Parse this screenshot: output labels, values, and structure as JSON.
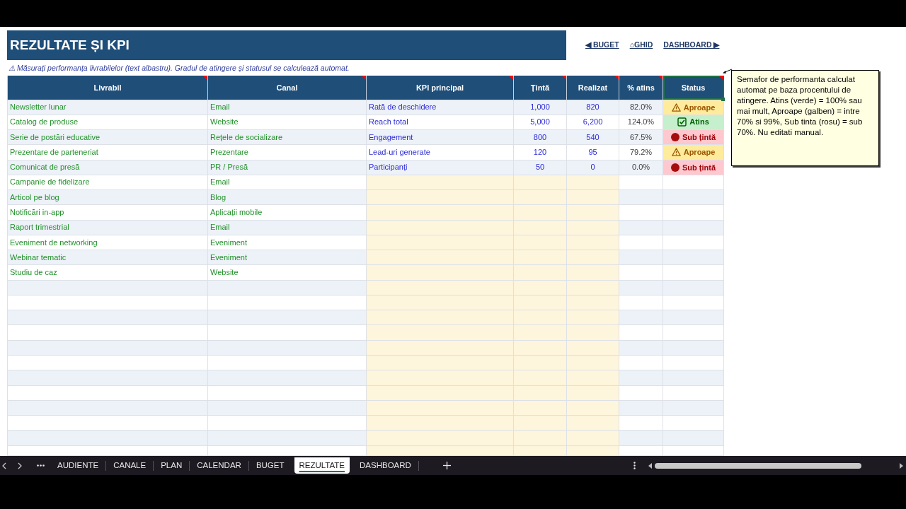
{
  "sheet": {
    "title": "REZULTATE ȘI KPI",
    "nav_links": [
      {
        "label": "◀ BUGET"
      },
      {
        "label": "⌂GHID"
      },
      {
        "label": "DASHBOARD ▶"
      }
    ],
    "note": "⚠ Măsurați performanța livrabilelor (text albastru). Gradul de atingere și statusul se calculează automat.",
    "table": {
      "columns": [
        {
          "label": "Livrabil",
          "comment": true,
          "selected": false
        },
        {
          "label": "Canal",
          "comment": true,
          "selected": false
        },
        {
          "label": "KPI principal",
          "comment": true,
          "selected": false
        },
        {
          "label": "Țintă",
          "comment": true,
          "selected": false
        },
        {
          "label": "Realizat",
          "comment": true,
          "selected": false
        },
        {
          "label": "% atins",
          "comment": true,
          "selected": false
        },
        {
          "label": "Status",
          "comment": true,
          "selected": true
        }
      ],
      "rows": [
        {
          "deliverable": "Newsletter lunar",
          "channel": "Email",
          "kpi": "Rată de deschidere",
          "target": "1,000",
          "actual": "820",
          "percent": "82.0%",
          "status": {
            "kind": "near",
            "label": "Aproape"
          }
        },
        {
          "deliverable": "Catalog de produse",
          "channel": "Website",
          "kpi": "Reach total",
          "target": "5,000",
          "actual": "6,200",
          "percent": "124.0%",
          "status": {
            "kind": "met",
            "label": "Atins"
          }
        },
        {
          "deliverable": "Serie de postări educative",
          "channel": "Rețele de socializare",
          "kpi": "Engagement",
          "target": "800",
          "actual": "540",
          "percent": "67.5%",
          "status": {
            "kind": "below",
            "label": "Sub țintă"
          }
        },
        {
          "deliverable": "Prezentare de parteneriat",
          "channel": "Prezentare",
          "kpi": "Lead-uri generate",
          "target": "120",
          "actual": "95",
          "percent": "79.2%",
          "status": {
            "kind": "near",
            "label": "Aproape"
          }
        },
        {
          "deliverable": "Comunicat de presă",
          "channel": "PR / Presă",
          "kpi": "Participanți",
          "target": "50",
          "actual": "0",
          "percent": "0.0%",
          "status": {
            "kind": "below",
            "label": "Sub țintă"
          }
        },
        {
          "deliverable": "Campanie de fidelizare",
          "channel": "Email"
        },
        {
          "deliverable": "Articol pe blog",
          "channel": "Blog"
        },
        {
          "deliverable": "Notificări in-app",
          "channel": "Aplicații mobile"
        },
        {
          "deliverable": "Raport trimestrial",
          "channel": "Email"
        },
        {
          "deliverable": "Eveniment de networking",
          "channel": "Eveniment"
        },
        {
          "deliverable": "Webinar tematic",
          "channel": "Eveniment"
        },
        {
          "deliverable": "Studiu de caz",
          "channel": "Website"
        }
      ]
    },
    "comment": {
      "text": "Semafor de performanta calculat automat pe baza procentului de atingere. Atins (verde) = 100% sau mai mult, Aproape (galben) = intre 70% si 99%, Sub tinta (rosu) = sub 70%. Nu editati manual."
    }
  },
  "sheet_tabs": {
    "tabs": [
      {
        "label": "AUDIENTE",
        "selected": false
      },
      {
        "label": "CANALE",
        "selected": false
      },
      {
        "label": "PLAN",
        "selected": false
      },
      {
        "label": "CALENDAR",
        "selected": false
      },
      {
        "label": "BUGET",
        "selected": false
      },
      {
        "label": "REZULTATE",
        "selected": true
      },
      {
        "label": "DASHBOARD",
        "selected": false
      }
    ]
  }
}
